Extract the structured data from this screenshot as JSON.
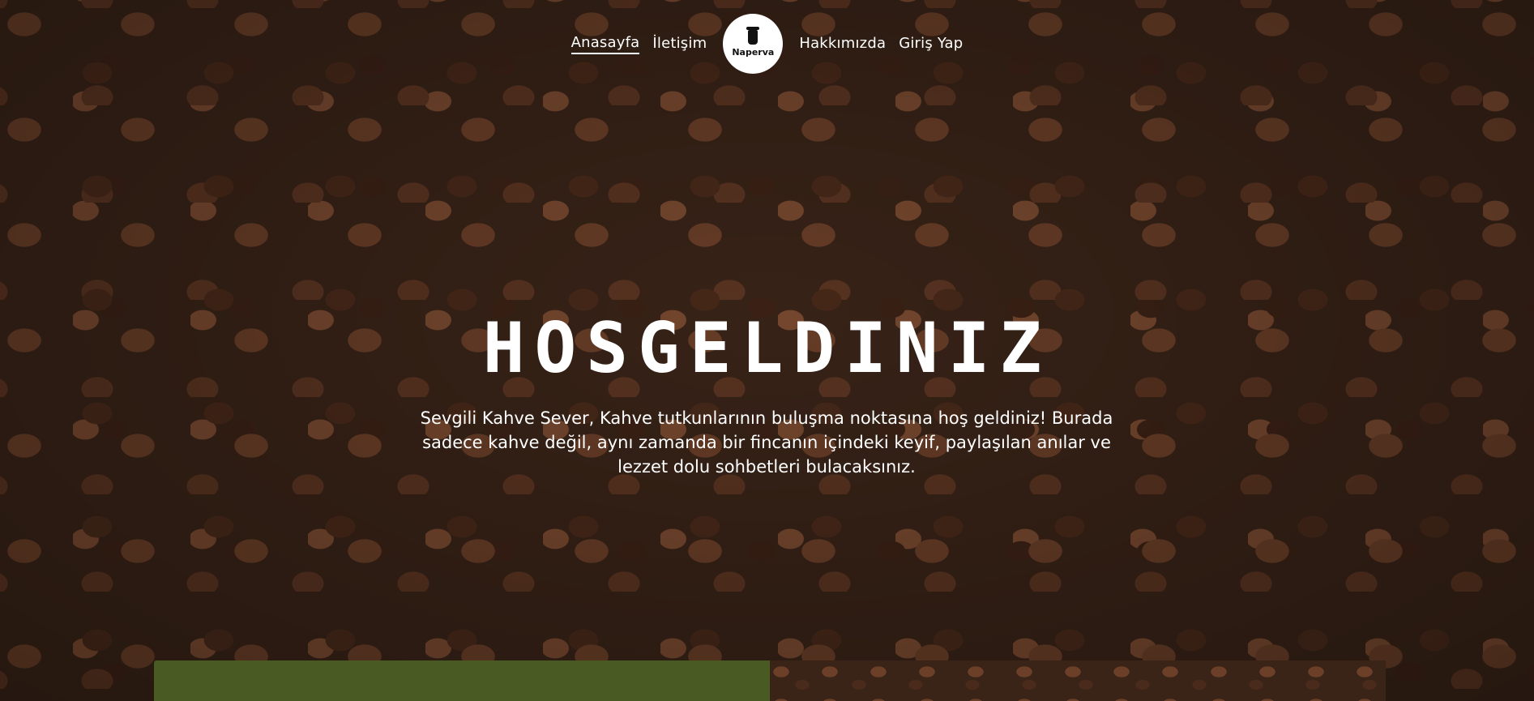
{
  "nav": {
    "items": [
      "Anasayfa",
      "İletişim",
      "Hakkımızda",
      "Giriş Yap"
    ],
    "logo_text": "Naperva"
  },
  "hero": {
    "title": "HOSGELDINIZ",
    "text": "Sevgili Kahve Sever, Kahve tutkunlarının buluşma noktasına hoş geldiniz! Burada sadece kahve değil, aynı zamanda bir fincanın içindeki keyif, paylaşılan anılar ve lezzet dolu sohbetleri bulacaksınız."
  },
  "colors": {
    "accent_green": "#4a5a23"
  }
}
